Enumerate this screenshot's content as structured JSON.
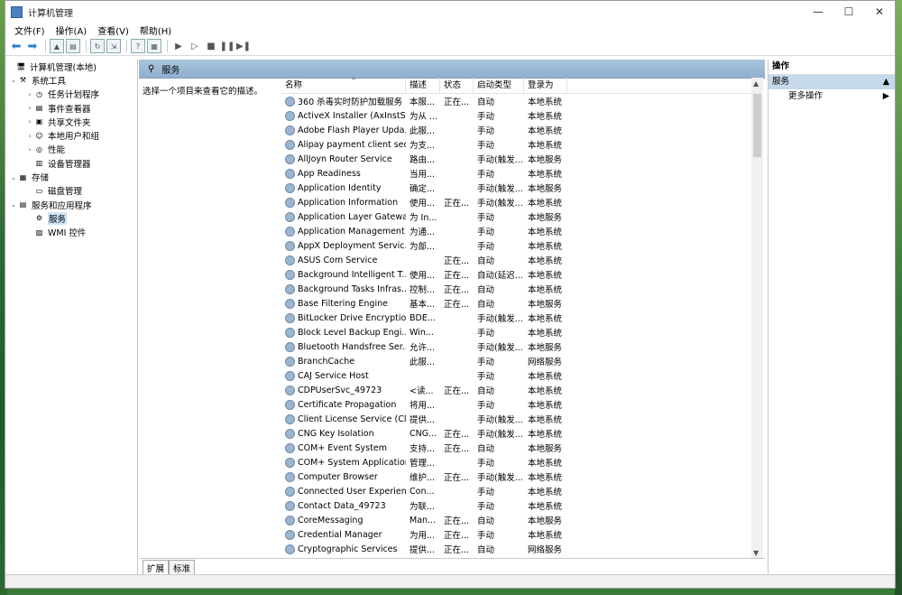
{
  "window": {
    "title": "计算机管理"
  },
  "menu": [
    "文件(F)",
    "操作(A)",
    "查看(V)",
    "帮助(H)"
  ],
  "tree": [
    {
      "label": "计算机管理(本地)",
      "level": 0,
      "arrow": "",
      "icon": "computer-icon"
    },
    {
      "label": "系统工具",
      "level": 1,
      "arrow": "⌄",
      "icon": "tools-icon"
    },
    {
      "label": "任务计划程序",
      "level": 2,
      "arrow": "›",
      "icon": "clock-icon"
    },
    {
      "label": "事件查看器",
      "level": 2,
      "arrow": "›",
      "icon": "event-icon"
    },
    {
      "label": "共享文件夹",
      "level": 2,
      "arrow": "›",
      "icon": "folder-icon"
    },
    {
      "label": "本地用户和组",
      "level": 2,
      "arrow": "›",
      "icon": "users-icon"
    },
    {
      "label": "性能",
      "level": 2,
      "arrow": "›",
      "icon": "performance-icon"
    },
    {
      "label": "设备管理器",
      "level": 2,
      "arrow": "",
      "icon": "device-icon"
    },
    {
      "label": "存储",
      "level": 1,
      "arrow": "⌄",
      "icon": "storage-icon"
    },
    {
      "label": "磁盘管理",
      "level": 2,
      "arrow": "",
      "icon": "disk-icon"
    },
    {
      "label": "服务和应用程序",
      "level": 1,
      "arrow": "⌄",
      "icon": "services-apps-icon"
    },
    {
      "label": "服务",
      "level": 2,
      "arrow": "",
      "icon": "services-icon",
      "selected": true
    },
    {
      "label": "WMI 控件",
      "level": 2,
      "arrow": "",
      "icon": "wmi-icon"
    }
  ],
  "center": {
    "header": "服务",
    "description": "选择一个项目来查看它的描述。",
    "columns": [
      "名称",
      "描述",
      "状态",
      "启动类型",
      "登录为"
    ],
    "rows": [
      [
        "360 杀毒实时防护加载服务",
        "本服...",
        "正在...",
        "自动",
        "本地系统"
      ],
      [
        "ActiveX Installer (AxInstSV)",
        "为从 ...",
        "",
        "手动",
        "本地系统"
      ],
      [
        "Adobe Flash Player Upda...",
        "此服...",
        "",
        "手动",
        "本地系统"
      ],
      [
        "Alipay payment client sec...",
        "为支...",
        "",
        "手动",
        "本地系统"
      ],
      [
        "AllJoyn Router Service",
        "路由...",
        "",
        "手动(触发...",
        "本地服务"
      ],
      [
        "App Readiness",
        "当用...",
        "",
        "手动",
        "本地系统"
      ],
      [
        "Application Identity",
        "确定...",
        "",
        "手动(触发...",
        "本地服务"
      ],
      [
        "Application Information",
        "使用...",
        "正在...",
        "手动(触发...",
        "本地系统"
      ],
      [
        "Application Layer Gatewa...",
        "为 In...",
        "",
        "手动",
        "本地服务"
      ],
      [
        "Application Management",
        "为通...",
        "",
        "手动",
        "本地系统"
      ],
      [
        "AppX Deployment Servic...",
        "为部...",
        "",
        "手动",
        "本地系统"
      ],
      [
        "ASUS Com Service",
        "",
        "正在...",
        "自动",
        "本地系统"
      ],
      [
        "Background Intelligent T...",
        "使用...",
        "正在...",
        "自动(延迟...",
        "本地系统"
      ],
      [
        "Background Tasks Infras...",
        "控制...",
        "正在...",
        "自动",
        "本地系统"
      ],
      [
        "Base Filtering Engine",
        "基本...",
        "正在...",
        "自动",
        "本地服务"
      ],
      [
        "BitLocker Drive Encryptio...",
        "BDE...",
        "",
        "手动(触发...",
        "本地系统"
      ],
      [
        "Block Level Backup Engi...",
        "Win...",
        "",
        "手动",
        "本地系统"
      ],
      [
        "Bluetooth Handsfree Ser...",
        "允许...",
        "",
        "手动(触发...",
        "本地服务"
      ],
      [
        "BranchCache",
        "此服...",
        "",
        "手动",
        "网络服务"
      ],
      [
        "CAJ Service Host",
        "",
        "",
        "手动",
        "本地系统"
      ],
      [
        "CDPUserSvc_49723",
        "<读...",
        "正在...",
        "自动",
        "本地系统"
      ],
      [
        "Certificate Propagation",
        "将用...",
        "",
        "手动",
        "本地系统"
      ],
      [
        "Client License Service (Cli...",
        "提供...",
        "",
        "手动(触发...",
        "本地系统"
      ],
      [
        "CNG Key Isolation",
        "CNG...",
        "正在...",
        "手动(触发...",
        "本地系统"
      ],
      [
        "COM+ Event System",
        "支持...",
        "正在...",
        "自动",
        "本地服务"
      ],
      [
        "COM+ System Application",
        "管理...",
        "",
        "手动",
        "本地系统"
      ],
      [
        "Computer Browser",
        "维护...",
        "正在...",
        "手动(触发...",
        "本地系统"
      ],
      [
        "Connected User Experien...",
        "Con...",
        "",
        "手动",
        "本地系统"
      ],
      [
        "Contact Data_49723",
        "为联...",
        "",
        "手动",
        "本地系统"
      ],
      [
        "CoreMessaging",
        "Man...",
        "正在...",
        "自动",
        "本地服务"
      ],
      [
        "Credential Manager",
        "为用...",
        "正在...",
        "手动",
        "本地系统"
      ],
      [
        "Cryptographic Services",
        "提供...",
        "正在...",
        "自动",
        "网络服务"
      ]
    ],
    "tabs": [
      "扩展",
      "标准"
    ]
  },
  "actions": {
    "header": "操作",
    "section": "服务",
    "more": "更多操作"
  },
  "colors": {
    "header_blue": "#a9c3dc",
    "selection": "#cce4f7",
    "action_section": "#c6d9ec"
  }
}
